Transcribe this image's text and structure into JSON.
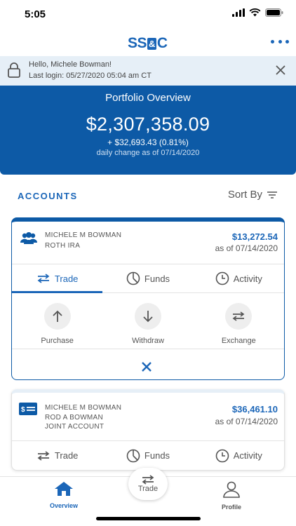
{
  "status_bar": {
    "time": "5:05"
  },
  "header": {
    "logo_left": "SS",
    "logo_amp": "&",
    "logo_right": "C"
  },
  "banner": {
    "greeting": "Hello, Michele Bowman!",
    "last_login": "Last login: 05/27/2020 05:04 am  CT"
  },
  "portfolio": {
    "title": "Portfolio Overview",
    "total": "$2,307,358.09",
    "change": "+ $32,693.43 (0.81%)",
    "as_of": "daily change as of 07/14/2020"
  },
  "accounts": {
    "heading": "ACCOUNTS",
    "sort_label": "Sort By"
  },
  "account1": {
    "owner": "MICHELE M BOWMAN",
    "type": "ROTH IRA",
    "value": "$13,272.54",
    "as_of": "as of 07/14/2020",
    "tabs": [
      "Trade",
      "Funds",
      "Activity"
    ],
    "actions": [
      "Purchase",
      "Withdraw",
      "Exchange"
    ]
  },
  "account2": {
    "owner": "MICHELE M BOWMAN",
    "co_owner": "ROD A BOWMAN",
    "type": "JOINT ACCOUNT",
    "value": "$36,461.10",
    "as_of": "as of 07/14/2020",
    "tabs": [
      "Trade",
      "Funds",
      "Activity"
    ]
  },
  "bottom_nav": {
    "overview": "Overview",
    "trade": "Trade",
    "profile": "Profile"
  },
  "colors": {
    "brand": "#1b66b8",
    "banner_bg": "#e6eff7",
    "portfolio_bg": "#0d5aa6"
  }
}
